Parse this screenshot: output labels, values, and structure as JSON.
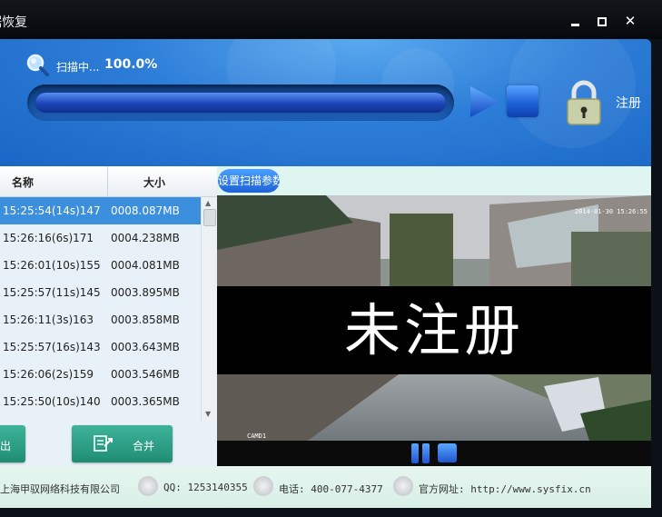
{
  "window": {
    "title": "据恢复",
    "minimize_icon": "minimize-icon",
    "maximize_icon": "maximize-icon",
    "close_label": "✕"
  },
  "scan": {
    "status_label": "扫描中...",
    "progress_text": "100.0%",
    "progress_fraction": 1.0,
    "register_label": "注册"
  },
  "file_list": {
    "columns": [
      "名称",
      "大小"
    ],
    "rows": [
      {
        "name": "15:25:54(14s)147",
        "size": "0008.087MB",
        "selected": true
      },
      {
        "name": "15:26:16(6s)171",
        "size": "0004.238MB"
      },
      {
        "name": "15:26:01(10s)155",
        "size": "0004.081MB"
      },
      {
        "name": "15:25:57(11s)145",
        "size": "0003.895MB"
      },
      {
        "name": "15:26:11(3s)163",
        "size": "0003.858MB"
      },
      {
        "name": "15:25:57(16s)143",
        "size": "0003.643MB"
      },
      {
        "name": "15:26:06(2s)159",
        "size": "0003.546MB"
      },
      {
        "name": "15:25:50(10s)140",
        "size": "0003.365MB"
      }
    ]
  },
  "buttons": {
    "export_label": "出",
    "merge_label": "合并"
  },
  "preview": {
    "settings_label": "设置扫描参数",
    "timestamp": "2014-01-30 15:26:55",
    "camera_label": "CAMD1",
    "watermark": "未注册"
  },
  "footer": {
    "company": "上海甲驭网络科技有限公司",
    "qq": "QQ: 1253140355",
    "phone": "电话: 400-077-4377",
    "website": "官方网址: http://www.sysfix.cn"
  },
  "colors": {
    "header_blue": "#2d7ed8",
    "selected_row": "#3b8fdc",
    "button_green": "#2aa085",
    "footer_bg": "#e6f6f0"
  }
}
